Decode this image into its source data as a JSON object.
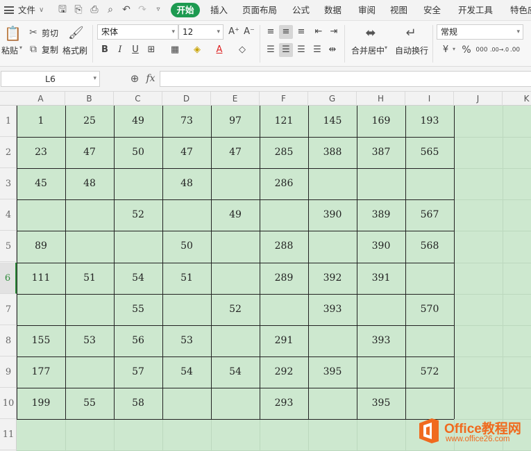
{
  "menubar": {
    "file": "文件",
    "tabs": [
      "开始",
      "插入",
      "页面布局",
      "公式",
      "数据",
      "审阅",
      "视图",
      "安全",
      "开发工具",
      "特色应"
    ]
  },
  "ribbon": {
    "paste": "粘贴",
    "cut": "剪切",
    "copy": "复制",
    "format_painter": "格式刷",
    "font_name": "宋体",
    "font_size": "12",
    "merge_center": "合并居中",
    "wrap_text": "自动换行",
    "number_format": "常规",
    "bold": "B",
    "italic": "I",
    "underline": "U",
    "font_color_glyph": "A",
    "percent": "%",
    "thousands": "000",
    "inc_decimal": ".00→.0",
    "dec_decimal": ".00"
  },
  "formula_bar": {
    "name_box": "L6",
    "fx": "fx",
    "value": ""
  },
  "sheet": {
    "columns": [
      "A",
      "B",
      "C",
      "D",
      "E",
      "F",
      "G",
      "H",
      "I",
      "J",
      "K"
    ],
    "rows": [
      "1",
      "2",
      "3",
      "4",
      "5",
      "6",
      "7",
      "8",
      "9",
      "10",
      "11"
    ],
    "active_row": "6",
    "cells": [
      [
        "1",
        "25",
        "49",
        "73",
        "97",
        "121",
        "145",
        "169",
        "193"
      ],
      [
        "23",
        "47",
        "50",
        "47",
        "47",
        "285",
        "388",
        "387",
        "565"
      ],
      [
        "45",
        "48",
        "",
        "48",
        "",
        "286",
        "",
        "",
        ""
      ],
      [
        "",
        "",
        "52",
        "",
        "49",
        "",
        "390",
        "389",
        "567"
      ],
      [
        "89",
        "",
        "",
        "50",
        "",
        "288",
        "",
        "390",
        "568"
      ],
      [
        "111",
        "51",
        "54",
        "51",
        "",
        "289",
        "392",
        "391",
        ""
      ],
      [
        "",
        "",
        "55",
        "",
        "52",
        "",
        "393",
        "",
        "570"
      ],
      [
        "155",
        "53",
        "56",
        "53",
        "",
        "291",
        "",
        "393",
        ""
      ],
      [
        "177",
        "",
        "57",
        "54",
        "54",
        "292",
        "395",
        "",
        "572"
      ],
      [
        "199",
        "55",
        "58",
        "",
        "",
        "293",
        "",
        "395",
        ""
      ]
    ]
  },
  "watermark": {
    "brand": "Office教程网",
    "url": "www.office26.com"
  },
  "colors": {
    "accent": "#1d9a50",
    "sheet_fill": "#cde8cf",
    "watermark": "#f06a1e"
  }
}
